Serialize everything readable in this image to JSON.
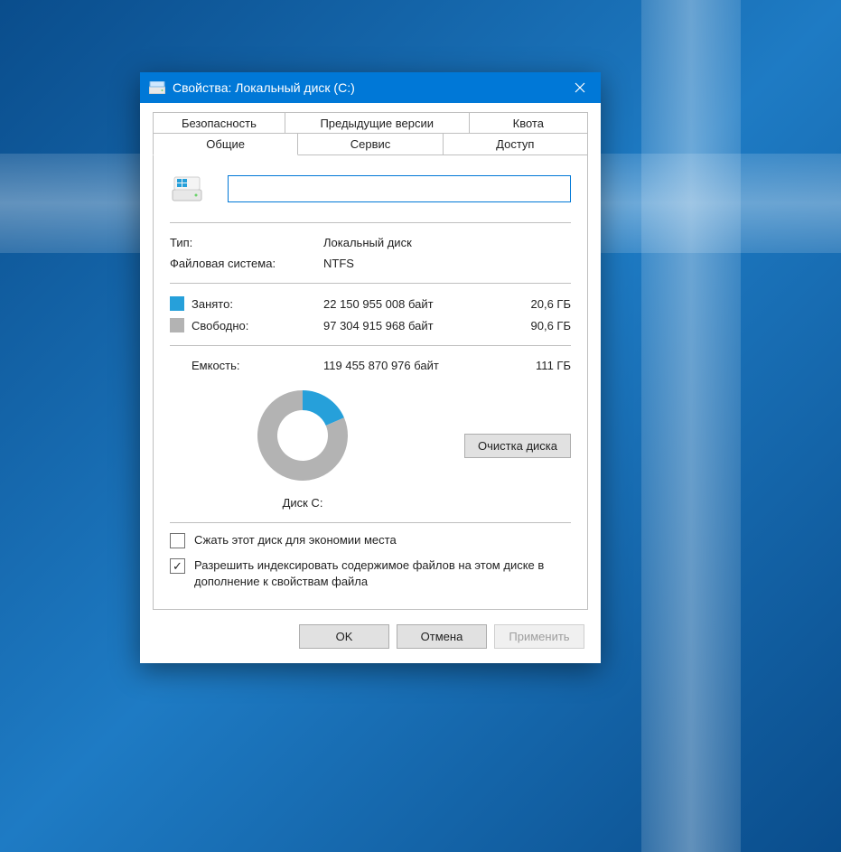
{
  "window": {
    "title": "Свойства: Локальный диск (C:)"
  },
  "tabs": {
    "security": "Безопасность",
    "previous_versions": "Предыдущие версии",
    "quota": "Квота",
    "general": "Общие",
    "tools": "Сервис",
    "sharing": "Доступ"
  },
  "general": {
    "name_value": "",
    "type_label": "Тип:",
    "type_value": "Локальный диск",
    "fs_label": "Файловая система:",
    "fs_value": "NTFS",
    "used_label": "Занято:",
    "used_bytes": "22 150 955 008 байт",
    "used_gb": "20,6 ГБ",
    "free_label": "Свободно:",
    "free_bytes": "97 304 915 968 байт",
    "free_gb": "90,6 ГБ",
    "capacity_label": "Емкость:",
    "capacity_bytes": "119 455 870 976 байт",
    "capacity_gb": "111 ГБ",
    "disk_label": "Диск C:",
    "cleanup_button": "Очистка диска",
    "compress_label": "Сжать этот диск для экономии места",
    "index_label": "Разрешить индексировать содержимое файлов на этом диске в дополнение к свойствам файла"
  },
  "colors": {
    "used": "#26a0da",
    "free": "#b3b3b3"
  },
  "buttons": {
    "ok": "OK",
    "cancel": "Отмена",
    "apply": "Применить"
  },
  "chart_data": {
    "type": "pie",
    "title": "Диск C:",
    "series": [
      {
        "name": "Занято",
        "value": 22150955008,
        "color": "#26a0da"
      },
      {
        "name": "Свободно",
        "value": 97304915968,
        "color": "#b3b3b3"
      }
    ],
    "total": 119455870976
  }
}
